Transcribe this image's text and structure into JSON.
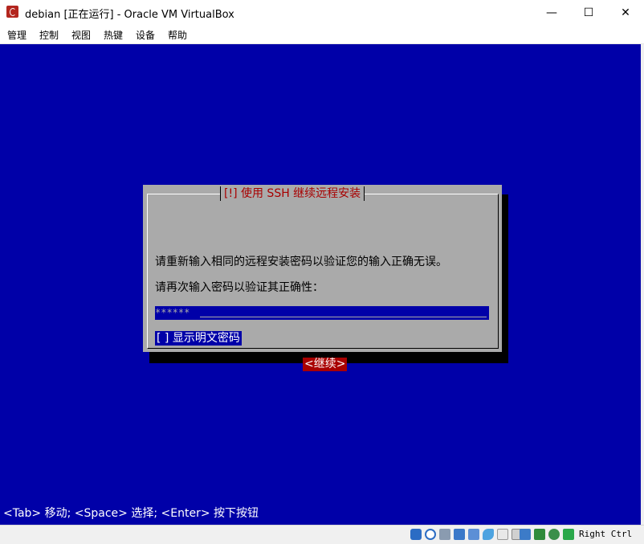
{
  "window": {
    "title": "debian [正在运行] - Oracle VM VirtualBox",
    "minimize_glyph": "—",
    "maximize_glyph": "☐",
    "close_glyph": "✕"
  },
  "menu": [
    "管理",
    "控制",
    "视图",
    "热键",
    "设备",
    "帮助"
  ],
  "dialog": {
    "title": "[!] 使用 SSH 继续远程安装",
    "message": "请重新输入相同的远程安装密码以验证您的输入正确无误。",
    "prompt": "请再次输入密码以验证其正确性：",
    "password_value": "******",
    "show_password_checkbox": "[ ] 显示明文密码",
    "continue_button": "<继续>"
  },
  "hint_bar": "<Tab> 移动; <Space> 选择; <Enter> 按下按钮",
  "statusbar": {
    "icons": [
      "hard-disk-icon",
      "optical-drive-icon",
      "audio-icon",
      "network-icon",
      "usb-icon",
      "shared-folders-icon",
      "display-icon",
      "video-capture-icon",
      "virtualization-icon",
      "mouse-integration-icon",
      "keyboard-capture-icon"
    ],
    "host_key": "Right Ctrl"
  },
  "colors": {
    "screen_bg": "#0000a8",
    "dialog_bg": "#aaaaaa",
    "title_red": "#a80000",
    "focus_bg": "#0000a8"
  }
}
